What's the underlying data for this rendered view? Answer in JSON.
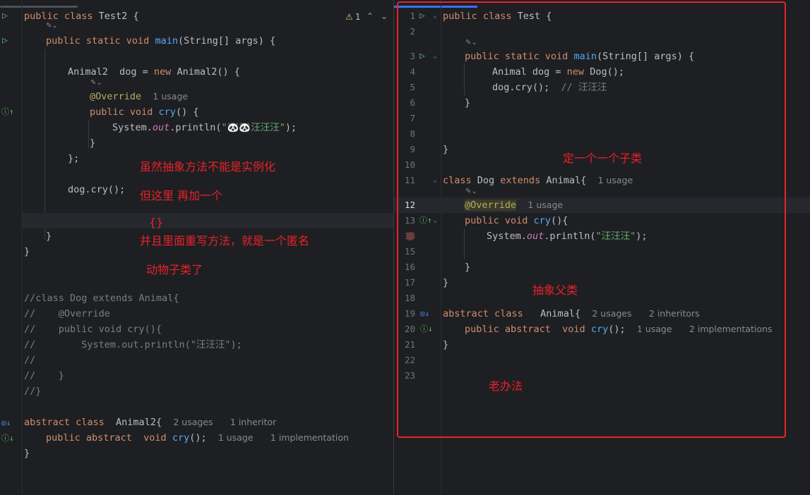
{
  "left": {
    "warning_count": "1",
    "lines": {
      "l1a": "public class ",
      "l1b": "Test2 {",
      "l2a": "public static void ",
      "l2b": "main",
      "l2c": "(String[] args) {",
      "l3a": "Animal2  dog = ",
      "l3b": "new ",
      "l3c": "Animal2() {",
      "l4a": "@Override",
      "l4b": "1 usage",
      "l5a": "public void ",
      "l5b": "cry",
      "l5c": "() {",
      "l6a": "System.",
      "l6b": "out",
      "l6c": ".println(",
      "l6d": "\"🐼🐼汪汪汪\"",
      "l6e": ");",
      "l7": "}",
      "l8": "};",
      "l9": "dog.cry();",
      "l10": "}",
      "l11": "}",
      "c1": "//class Dog extends Animal{",
      "c2": "//    @Override",
      "c3": "//    public void cry(){",
      "c4": "//        System.out.println(\"汪汪汪\");",
      "c5": "//",
      "c6": "//    }",
      "c7": "//}",
      "a1a": "abstract class ",
      "a1b": " Animal2{",
      "a1c": "2 usages",
      "a1d": "1 inheritor",
      "a2a": "public abstract ",
      "a2b": " void ",
      "a2c": "cry",
      "a2d": "();",
      "a2e": "1 usage",
      "a2f": "1 implementation",
      "a3": "}"
    },
    "notes": {
      "n1": "虽然抽象方法不能是实例化",
      "n2": "但这里 再加一个",
      "n3": "{}",
      "n4": "并且里面重写方法，就是一个匿名",
      "n5": "动物子类了"
    }
  },
  "right": {
    "line_numbers": [
      "1",
      "2",
      "3",
      "4",
      "5",
      "6",
      "7",
      "8",
      "9",
      "10",
      "11",
      "12",
      "13",
      "14",
      "15",
      "16",
      "17",
      "18",
      "19",
      "20",
      "21",
      "22",
      "23"
    ],
    "lines": {
      "r1a": "public class ",
      "r1b": "Test {",
      "r3a": "public static void ",
      "r3b": "main",
      "r3c": "(String[] args) {",
      "r4a": "Animal dog = ",
      "r4b": "new ",
      "r4c": "Dog();",
      "r5a": "dog.cry();  ",
      "r5b": "// 汪汪汪",
      "r6": "}",
      "r9": "}",
      "r11a": "class ",
      "r11b": "Dog ",
      "r11c": "extends ",
      "r11d": "Animal{",
      "r11e": "1 usage",
      "r12a": "@Override",
      "r12b": "1 usage",
      "r13a": "public void ",
      "r13b": "cry",
      "r13c": "(){",
      "r14a": "System.",
      "r14b": "out",
      "r14c": ".println(",
      "r14d": "\"汪汪汪\"",
      "r14e": ");",
      "r16": "}",
      "r17": "}",
      "r19a": "abstract class ",
      "r19b": "  Animal{",
      "r19c": "2 usages",
      "r19d": "2 inheritors",
      "r20a": "public abstract ",
      "r20b": " void ",
      "r20c": "cry",
      "r20d": "();",
      "r20e": "1 usage",
      "r20f": "2 implementations",
      "r21": "}"
    },
    "notes": {
      "n1": "定一个一个子类",
      "n2": "抽象父类",
      "n3": "老办法"
    }
  }
}
